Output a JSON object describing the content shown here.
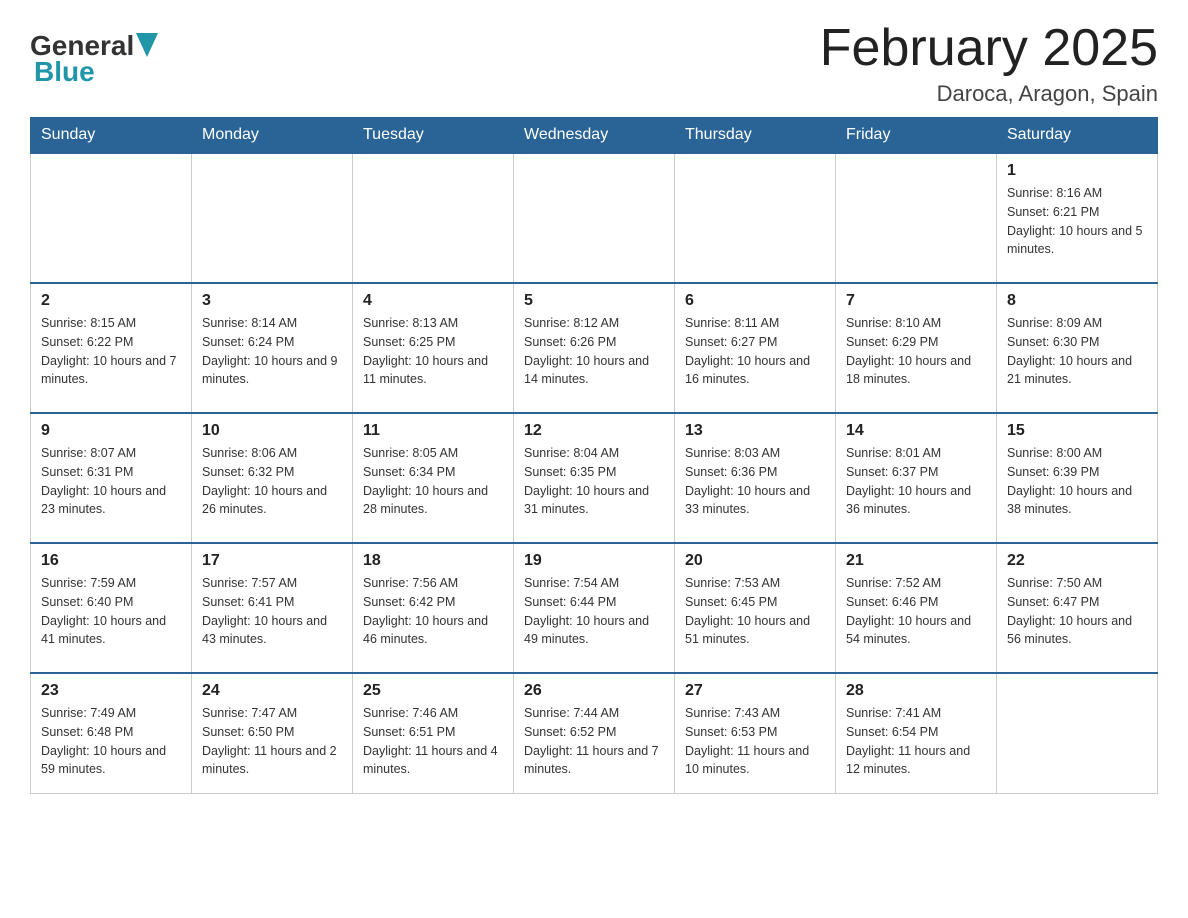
{
  "header": {
    "logo_general": "General",
    "logo_blue": "Blue",
    "month_title": "February 2025",
    "location": "Daroca, Aragon, Spain"
  },
  "weekdays": [
    "Sunday",
    "Monday",
    "Tuesday",
    "Wednesday",
    "Thursday",
    "Friday",
    "Saturday"
  ],
  "weeks": [
    [
      {
        "day": "",
        "info": ""
      },
      {
        "day": "",
        "info": ""
      },
      {
        "day": "",
        "info": ""
      },
      {
        "day": "",
        "info": ""
      },
      {
        "day": "",
        "info": ""
      },
      {
        "day": "",
        "info": ""
      },
      {
        "day": "1",
        "info": "Sunrise: 8:16 AM\nSunset: 6:21 PM\nDaylight: 10 hours and 5 minutes."
      }
    ],
    [
      {
        "day": "2",
        "info": "Sunrise: 8:15 AM\nSunset: 6:22 PM\nDaylight: 10 hours and 7 minutes."
      },
      {
        "day": "3",
        "info": "Sunrise: 8:14 AM\nSunset: 6:24 PM\nDaylight: 10 hours and 9 minutes."
      },
      {
        "day": "4",
        "info": "Sunrise: 8:13 AM\nSunset: 6:25 PM\nDaylight: 10 hours and 11 minutes."
      },
      {
        "day": "5",
        "info": "Sunrise: 8:12 AM\nSunset: 6:26 PM\nDaylight: 10 hours and 14 minutes."
      },
      {
        "day": "6",
        "info": "Sunrise: 8:11 AM\nSunset: 6:27 PM\nDaylight: 10 hours and 16 minutes."
      },
      {
        "day": "7",
        "info": "Sunrise: 8:10 AM\nSunset: 6:29 PM\nDaylight: 10 hours and 18 minutes."
      },
      {
        "day": "8",
        "info": "Sunrise: 8:09 AM\nSunset: 6:30 PM\nDaylight: 10 hours and 21 minutes."
      }
    ],
    [
      {
        "day": "9",
        "info": "Sunrise: 8:07 AM\nSunset: 6:31 PM\nDaylight: 10 hours and 23 minutes."
      },
      {
        "day": "10",
        "info": "Sunrise: 8:06 AM\nSunset: 6:32 PM\nDaylight: 10 hours and 26 minutes."
      },
      {
        "day": "11",
        "info": "Sunrise: 8:05 AM\nSunset: 6:34 PM\nDaylight: 10 hours and 28 minutes."
      },
      {
        "day": "12",
        "info": "Sunrise: 8:04 AM\nSunset: 6:35 PM\nDaylight: 10 hours and 31 minutes."
      },
      {
        "day": "13",
        "info": "Sunrise: 8:03 AM\nSunset: 6:36 PM\nDaylight: 10 hours and 33 minutes."
      },
      {
        "day": "14",
        "info": "Sunrise: 8:01 AM\nSunset: 6:37 PM\nDaylight: 10 hours and 36 minutes."
      },
      {
        "day": "15",
        "info": "Sunrise: 8:00 AM\nSunset: 6:39 PM\nDaylight: 10 hours and 38 minutes."
      }
    ],
    [
      {
        "day": "16",
        "info": "Sunrise: 7:59 AM\nSunset: 6:40 PM\nDaylight: 10 hours and 41 minutes."
      },
      {
        "day": "17",
        "info": "Sunrise: 7:57 AM\nSunset: 6:41 PM\nDaylight: 10 hours and 43 minutes."
      },
      {
        "day": "18",
        "info": "Sunrise: 7:56 AM\nSunset: 6:42 PM\nDaylight: 10 hours and 46 minutes."
      },
      {
        "day": "19",
        "info": "Sunrise: 7:54 AM\nSunset: 6:44 PM\nDaylight: 10 hours and 49 minutes."
      },
      {
        "day": "20",
        "info": "Sunrise: 7:53 AM\nSunset: 6:45 PM\nDaylight: 10 hours and 51 minutes."
      },
      {
        "day": "21",
        "info": "Sunrise: 7:52 AM\nSunset: 6:46 PM\nDaylight: 10 hours and 54 minutes."
      },
      {
        "day": "22",
        "info": "Sunrise: 7:50 AM\nSunset: 6:47 PM\nDaylight: 10 hours and 56 minutes."
      }
    ],
    [
      {
        "day": "23",
        "info": "Sunrise: 7:49 AM\nSunset: 6:48 PM\nDaylight: 10 hours and 59 minutes."
      },
      {
        "day": "24",
        "info": "Sunrise: 7:47 AM\nSunset: 6:50 PM\nDaylight: 11 hours and 2 minutes."
      },
      {
        "day": "25",
        "info": "Sunrise: 7:46 AM\nSunset: 6:51 PM\nDaylight: 11 hours and 4 minutes."
      },
      {
        "day": "26",
        "info": "Sunrise: 7:44 AM\nSunset: 6:52 PM\nDaylight: 11 hours and 7 minutes."
      },
      {
        "day": "27",
        "info": "Sunrise: 7:43 AM\nSunset: 6:53 PM\nDaylight: 11 hours and 10 minutes."
      },
      {
        "day": "28",
        "info": "Sunrise: 7:41 AM\nSunset: 6:54 PM\nDaylight: 11 hours and 12 minutes."
      },
      {
        "day": "",
        "info": ""
      }
    ]
  ]
}
